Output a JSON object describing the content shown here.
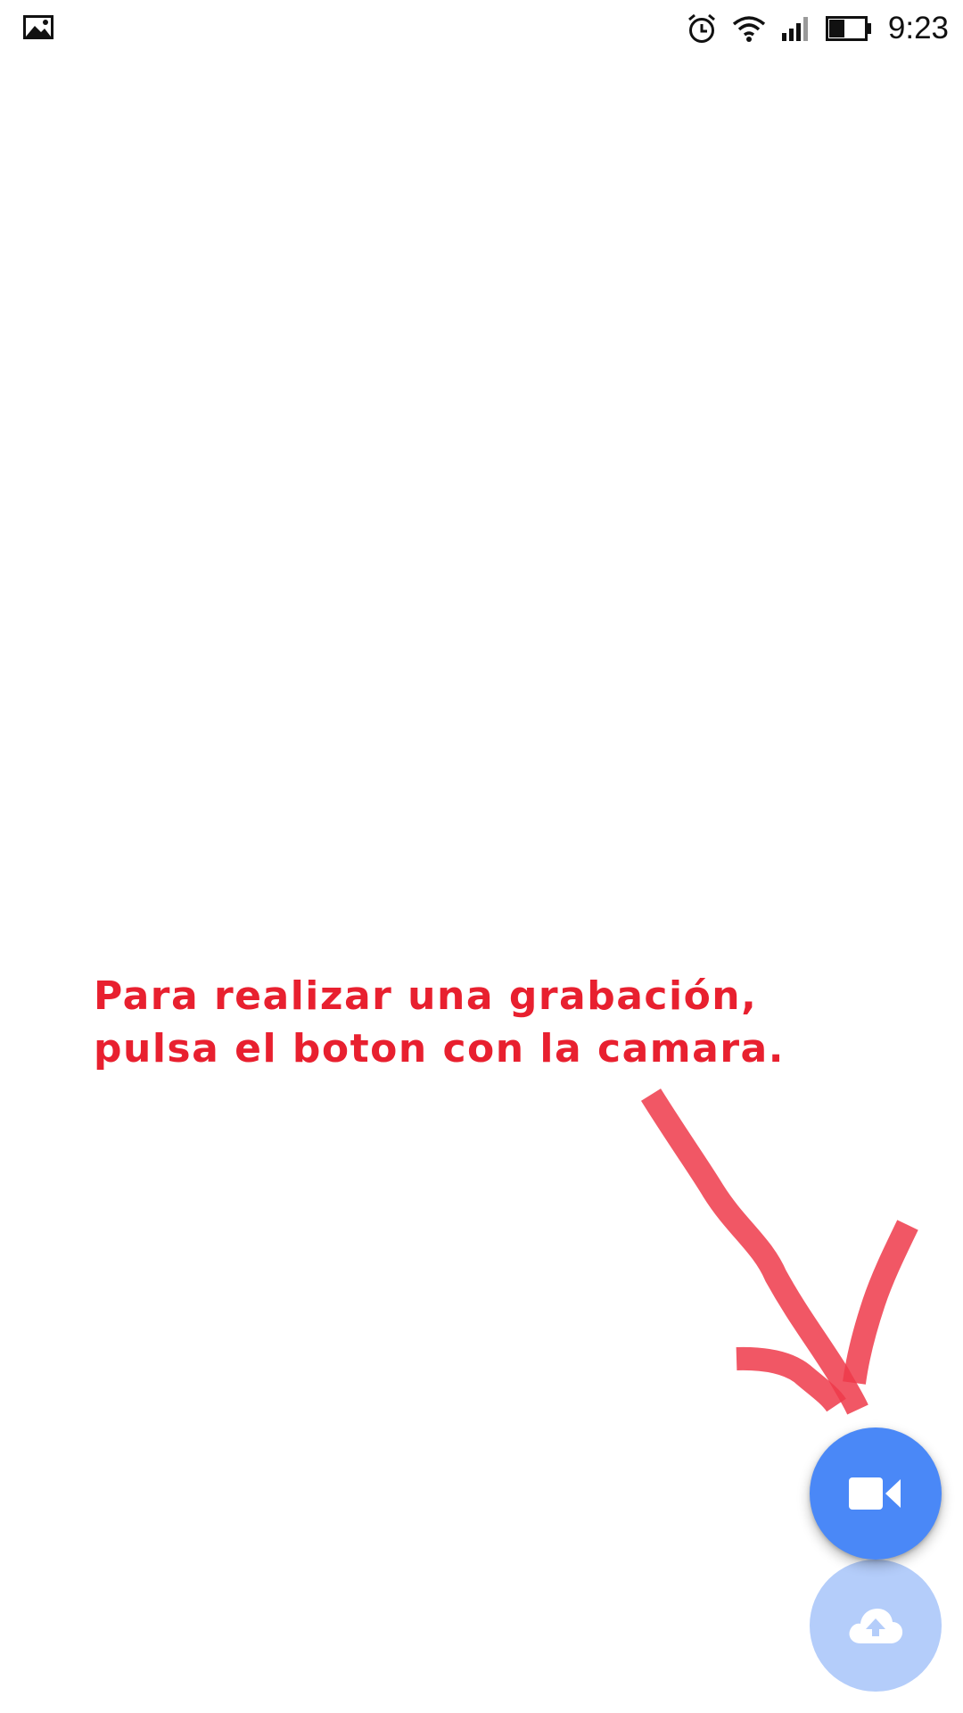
{
  "status_bar": {
    "time": "9:23",
    "left_icon": "image-notification-icon",
    "icons": [
      "alarm-icon",
      "wifi-icon",
      "signal-icon",
      "battery-icon"
    ]
  },
  "annotation": {
    "text": "Para realizar una grabación,\npulsa el boton con la camara.",
    "color": "#e8202f"
  },
  "fabs": {
    "record": {
      "icon": "video-camera-icon",
      "color": "#4a88f7"
    },
    "upload": {
      "icon": "cloud-upload-icon",
      "color": "#b4cdfa"
    }
  }
}
